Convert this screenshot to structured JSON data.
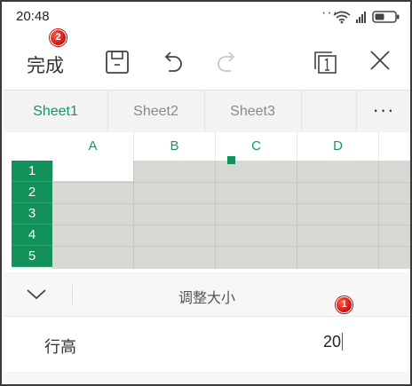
{
  "status_bar": {
    "time": "20:48",
    "dots": "···"
  },
  "toolbar": {
    "done_label": "完成"
  },
  "badges": {
    "toolbar_badge": "2",
    "panel_badge": "1"
  },
  "sheet_tabs": [
    {
      "label": "Sheet1",
      "active": true
    },
    {
      "label": "Sheet2",
      "active": false
    },
    {
      "label": "Sheet3",
      "active": false
    }
  ],
  "more_label": "···",
  "grid": {
    "columns": [
      "A",
      "B",
      "C",
      "D"
    ],
    "rows": [
      "1",
      "2",
      "3",
      "4",
      "5"
    ]
  },
  "panel": {
    "title": "调整大小",
    "row_height_label": "行高",
    "row_height_value": "20"
  },
  "colors": {
    "accent": "#12915a",
    "badge": "#d0190f",
    "selection_fill": "#d5d8d3"
  },
  "icons": {
    "save": "save-icon",
    "undo": "undo-icon",
    "redo": "redo-icon",
    "sheets": "sheet-switch-icon",
    "close": "close-icon",
    "collapse": "chevron-down-icon"
  }
}
